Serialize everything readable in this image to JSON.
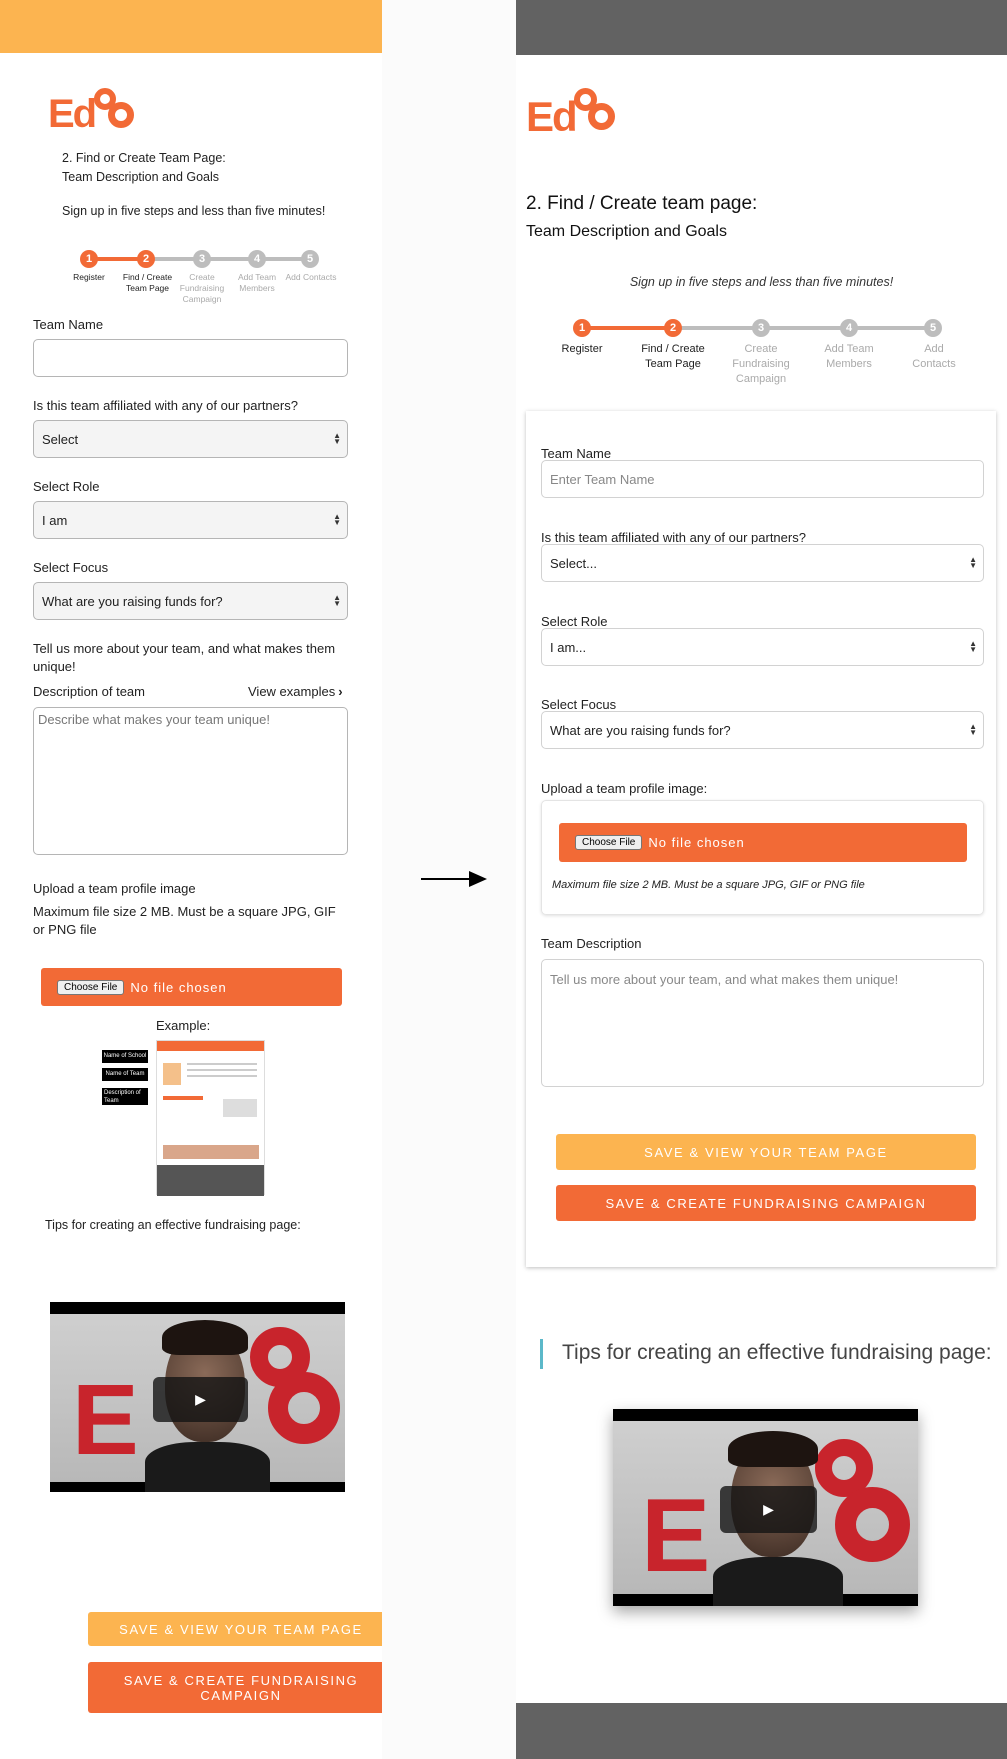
{
  "left": {
    "step_title": "2. Find or Create Team Page:",
    "step_subtitle": "Team Description and Goals",
    "intro": "Sign up in five steps and less than five minutes!",
    "steps": [
      {
        "num": "1",
        "label": "Register"
      },
      {
        "num": "2",
        "label": "Find / Create Team Page"
      },
      {
        "num": "3",
        "label": "Create Fundraising Campaign"
      },
      {
        "num": "4",
        "label": "Add Team Members"
      },
      {
        "num": "5",
        "label": "Add Contacts"
      }
    ],
    "team_name_label": "Team Name",
    "partners_label": "Is this team affiliated with any of our partners?",
    "partners_value": "Select",
    "role_label": "Select Role",
    "role_value": "I am",
    "focus_label": "Select Focus",
    "focus_value": "What are you raising funds for?",
    "tell_us": "Tell us more about your team, and what makes them unique!",
    "description_label": "Description of team",
    "view_examples": "View examples",
    "description_placeholder": "Describe what makes your team unique!",
    "upload_label": "Upload a team profile image",
    "upload_note": "Maximum file size 2 MB. Must be a square JPG, GIF or PNG file",
    "choose_file": "Choose File",
    "no_file": "No file chosen",
    "example_label": "Example:",
    "example_tags": [
      "Name of School",
      "Name of Team",
      "Description of Team"
    ],
    "tips": "Tips for creating an effective fundraising page:",
    "save_view": "SAVE & VIEW YOUR TEAM PAGE",
    "save_create": "SAVE & CREATE FUNDRAISING CAMPAIGN"
  },
  "right": {
    "step_title": "2. Find / Create team page:",
    "step_subtitle": "Team Description and Goals",
    "intro": "Sign up in five steps and less than five minutes!",
    "steps": [
      {
        "num": "1",
        "label": "Register"
      },
      {
        "num": "2",
        "label": "Find / Create Team Page"
      },
      {
        "num": "3",
        "label": "Create Fundraising Campaign"
      },
      {
        "num": "4",
        "label": "Add Team Members"
      },
      {
        "num": "5",
        "label": "Add Contacts"
      }
    ],
    "team_name_label": "Team Name",
    "team_name_placeholder": "Enter Team Name",
    "partners_label": "Is this team affiliated with any of our partners?",
    "partners_value": "Select...",
    "role_label": "Select Role",
    "role_value": "I am...",
    "focus_label": "Select Focus",
    "focus_value": "What are you raising funds for?",
    "upload_label": "Upload a team profile image:",
    "choose_file": "Choose File",
    "no_file": "No file chosen",
    "upload_note": "Maximum file size 2 MB. Must be a square JPG, GIF or PNG file",
    "description_label": "Team Description",
    "description_placeholder": "Tell us more about your team, and what makes them unique!",
    "save_view": "SAVE & VIEW YOUR TEAM PAGE",
    "save_create": "SAVE & CREATE FUNDRAISING CAMPAIGN",
    "tips": "Tips for creating an effective fundraising page:"
  },
  "logo_text": "EdCo",
  "colors": {
    "orange": "#f26a36",
    "yellow": "#fcb450",
    "gray_bar": "#626262",
    "teal_accent": "#5bb8c9",
    "step_inactive": "#bdbdbd"
  },
  "icons": [
    "arrow-right-icon",
    "play-icon",
    "chevron-right-icon",
    "select-arrows-icon"
  ]
}
